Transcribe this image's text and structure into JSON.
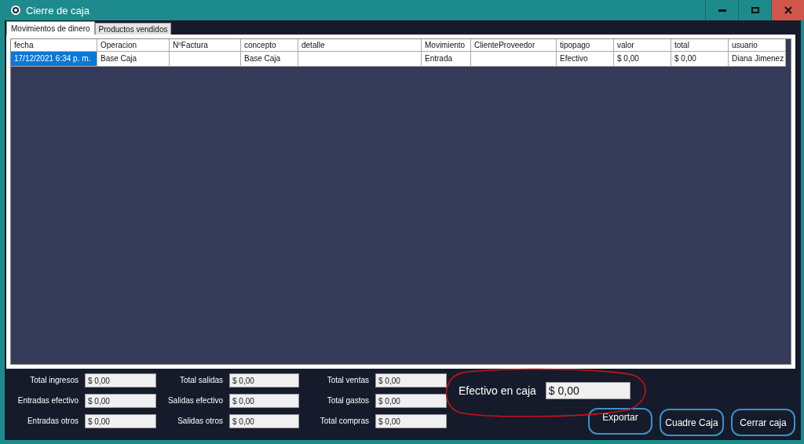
{
  "window": {
    "title": "Cierre de caja"
  },
  "tabs": [
    {
      "label": "Movimientos de dinero",
      "selected": true
    },
    {
      "label": "Productos vendidos",
      "selected": false
    }
  ],
  "table": {
    "columns": [
      "fecha",
      "Operacion",
      "NºFactura",
      "concepto",
      "detalle",
      "Movimiento",
      "ClienteProveedor",
      "tipopago",
      "valor",
      "total",
      "usuario"
    ],
    "rows": [
      {
        "cells": [
          {
            "text": "17/12/2021 6:34 p. m.",
            "selected": true
          },
          {
            "text": "Base Caja",
            "selected": false
          },
          {
            "selected": false
          },
          {
            "text": "Base Caja",
            "selected": false
          },
          {
            "selected": false
          },
          {
            "text": "Entrada",
            "selected": false
          },
          {
            "selected": false
          },
          {
            "text": "Efectivo",
            "selected": false
          },
          {
            "text": "$ 0,00",
            "selected": false
          },
          {
            "text": "$ 0,00",
            "selected": false
          },
          {
            "text": "Diana Jimenez",
            "selected": false
          }
        ]
      }
    ]
  },
  "totals": [
    {
      "label": "Total ingresos",
      "value": "$ 0,00"
    },
    {
      "label": "Total salidas",
      "value": "$ 0,00"
    },
    {
      "label": "Total ventas",
      "value": "$ 0,00"
    },
    {
      "label": "Entradas efectivo",
      "value": "$ 0,00"
    },
    {
      "label": "Salidas efectivo",
      "value": "$ 0,00"
    },
    {
      "label": "Total gastos",
      "value": "$ 0,00"
    },
    {
      "label": "Entradas otros",
      "value": "$ 0,00"
    },
    {
      "label": "Salidas otros",
      "value": "$ 0,00"
    },
    {
      "label": "Total compras",
      "value": "$ 0,00"
    }
  ],
  "cash": {
    "label": "Efectivo en caja",
    "value": "$ 0,00"
  },
  "buttons": [
    "Exportar",
    "Cuadre Caja",
    "Cerrar caja"
  ]
}
